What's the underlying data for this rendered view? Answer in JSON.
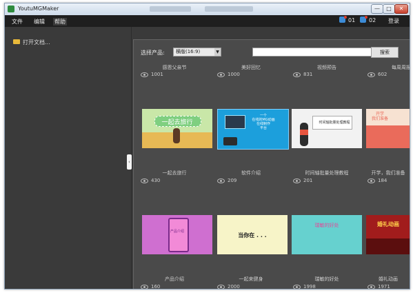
{
  "window": {
    "title": "YoutuMGMaker",
    "controls": [
      "—",
      "□",
      "✕"
    ]
  },
  "menu": [
    "文件",
    "编辑",
    "帮助"
  ],
  "header": {
    "stat1": "01",
    "stat2": "02",
    "login": "登录"
  },
  "sidebar": {
    "open_doc": "打开文档..."
  },
  "toolbar": {
    "filter_label": "选择产品:",
    "filter_value": "横版(16:9)",
    "search_value": "",
    "search_button": "搜索"
  },
  "rows": [
    {
      "titles": [
        "感恩父亲节",
        "美好回忆",
        "视频预告",
        "每周周报"
      ],
      "views": [
        "1001",
        "1000",
        "831",
        "602"
      ]
    },
    {
      "titles": [
        "一起去旅行",
        "软件介绍",
        "时间轴批量处理教程",
        "开学，我们准备"
      ],
      "views": [
        "430",
        "209",
        "201",
        "184"
      ],
      "thumb_text": [
        "一起去旅行",
        "一个\n在线的MG动画\n在线制作\n平台",
        "时间轴批量处理教程",
        "开学\n我们准备"
      ]
    },
    {
      "titles": [
        "产品介绍",
        "一起来健身",
        "瑞敏的好处",
        "婚礼动画"
      ],
      "views": [
        "160",
        "2000",
        "1998",
        "1971"
      ],
      "thumb_text": [
        "产品介绍",
        "当你在 . . .",
        "瑞敏的好处",
        "婚礼动画"
      ]
    }
  ],
  "colors": {
    "thumb_bg": [
      "#c9e7a8",
      "#1c9fdc",
      "#f2f2f2",
      "#ea6b5b",
      "#cf6fd0",
      "#f7f4c8",
      "#66d1cf",
      "#a11c1c"
    ]
  }
}
